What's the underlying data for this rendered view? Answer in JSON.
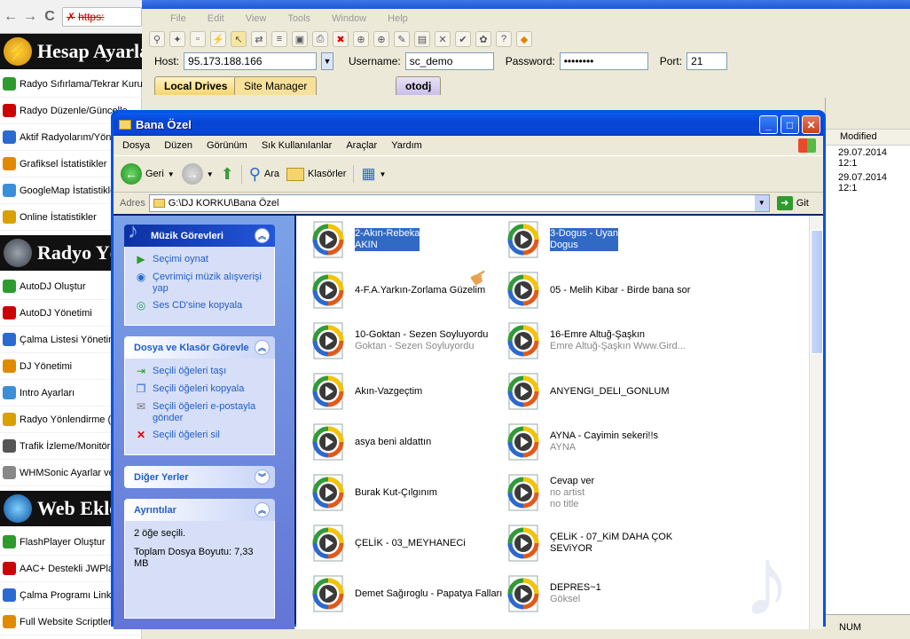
{
  "browser": {
    "url": "https:"
  },
  "left_panel": {
    "banners": [
      {
        "label": "Hesap Ayarları"
      },
      {
        "label": "Radyo Yönetimi"
      },
      {
        "label": "Web Ekleri"
      }
    ],
    "section1": [
      "Radyo Sıfırlama/Tekrar Kurulum",
      "Radyo Düzenle/Güncelle",
      "Aktif Radyolarım/Yönet",
      "Grafiksel İstatistikler",
      "GoogleMap İstatistikleri",
      "Online İstatistikler"
    ],
    "section2": [
      "AutoDJ Oluştur",
      "AutoDJ Yönetimi",
      "Çalma Listesi Yönetimi",
      "DJ Yönetimi",
      "Intro Ayarları",
      "Radyo Yönlendirme (Relay)",
      "Trafik İzleme/Monitör",
      "WHMSonic Ayarlar ve"
    ],
    "section3": [
      "FlashPlayer Oluştur",
      "AAC+ Destekli JWPlayer",
      "Çalma Programı Linkleri",
      "Full Website Scriptleri"
    ]
  },
  "ftp": {
    "menu": [
      "File",
      "Edit",
      "View",
      "Tools",
      "Window",
      "Help"
    ],
    "host_label": "Host:",
    "host_value": "95.173.188.166",
    "user_label": "Username:",
    "user_value": "sc_demo",
    "pass_label": "Password:",
    "pass_value": "••••••••",
    "port_label": "Port:",
    "port_value": "21",
    "tabs": [
      "Local Drives",
      "Site Manager"
    ],
    "remote_tab": "otodj",
    "modified_header": "Modified",
    "modified_rows": [
      "29.07.2014 12:1",
      "29.07.2014 12:1"
    ],
    "status_num": "NUM"
  },
  "explorer": {
    "title": "Bana Özel",
    "menu": [
      "Dosya",
      "Düzen",
      "Görünüm",
      "Sık Kullanılanlar",
      "Araçlar",
      "Yardım"
    ],
    "toolbar": {
      "back": "Geri",
      "search": "Ara",
      "folders": "Klasörler"
    },
    "address_label": "Adres",
    "address_value": "G:\\DJ KORKU\\Bana Özel",
    "go_label": "Git",
    "music_tasks": {
      "title": "Müzik Görevleri",
      "items": [
        "Seçimi oynat",
        "Çevrimiçi müzik alışverişi yap",
        "Ses CD'sine kopyala"
      ]
    },
    "file_tasks": {
      "title": "Dosya ve Klasör Görevleri",
      "items": [
        "Seçili öğeleri taşı",
        "Seçili öğeleri kopyala",
        "Seçili öğeleri e-postayla gönder",
        "Seçili öğeleri sil"
      ]
    },
    "other_places": {
      "title": "Diğer Yerler"
    },
    "details": {
      "title": "Ayrıntılar",
      "selected": "2 öğe seçili.",
      "total": "Toplam Dosya Boyutu: 7,33 MB"
    },
    "files": [
      {
        "name": "2-Akın-Rebeka",
        "sub": "AKIN",
        "selected": true
      },
      {
        "name": "3-Dogus - Uyan",
        "sub": "Dogus",
        "selected": true
      },
      {
        "name": "4-F.A.Yarkın-Zorlama Güzelim",
        "sub": ""
      },
      {
        "name": "05 - Melih Kibar - Birde bana sor",
        "sub": ""
      },
      {
        "name": "10-Goktan - Sezen Soyluyordu",
        "sub": "Goktan - Sezen Soyluyordu"
      },
      {
        "name": "16-Emre Altuğ-Şaşkın",
        "sub": "Emre Altuğ-Şaşkın  Www.Gird..."
      },
      {
        "name": "Akın-Vazgeçtim",
        "sub": ""
      },
      {
        "name": "ANYENGI_DELI_GONLUM",
        "sub": ""
      },
      {
        "name": "asya beni aldattın",
        "sub": ""
      },
      {
        "name": "AYNA - Cayimin sekeri!!s",
        "sub": "AYNA"
      },
      {
        "name": "Burak Kut-Çılgınım",
        "sub": ""
      },
      {
        "name": "Cevap ver",
        "sub": "no artist",
        "sub2": "no title"
      },
      {
        "name": "ÇELİK - 03_MEYHANECi",
        "sub": ""
      },
      {
        "name": "ÇELiK - 07_KiM DAHA ÇOK SEViYOR",
        "sub": ""
      },
      {
        "name": "Demet Sağıroglu - Papatya Falları",
        "sub": ""
      },
      {
        "name": "DEPRES~1",
        "sub": "Göksel"
      }
    ]
  }
}
